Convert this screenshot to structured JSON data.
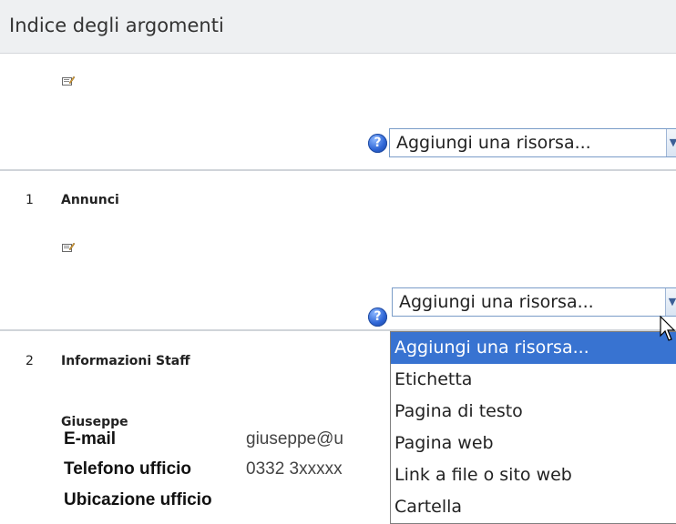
{
  "header": {
    "title": "Indice degli argomenti"
  },
  "sections": [
    {
      "number": "",
      "title": "",
      "add_resource_label": "Aggiungi una risorsa..."
    },
    {
      "number": "1",
      "title": "Annunci",
      "add_resource_label": "Aggiungi una risorsa..."
    },
    {
      "number": "2",
      "title": "Informazioni Staff"
    }
  ],
  "staff": {
    "name": "Giuseppe",
    "rows": [
      {
        "label": "E-mail",
        "value": "giuseppe@u"
      },
      {
        "label": "Telefono ufficio",
        "value": "0332 3xxxxx"
      },
      {
        "label": "Ubicazione ufficio",
        "value": ""
      }
    ]
  },
  "dropdown": {
    "options": [
      "Aggiungi una risorsa...",
      "Etichetta",
      "Pagina di testo",
      "Pagina web",
      "Link a file o sito web",
      "Cartella"
    ],
    "selected_index": 0
  },
  "colors": {
    "header_bg": "#eef0f2",
    "selected_option_bg": "#3873d1",
    "help_icon": "#2f66d6"
  },
  "icons": {
    "edit_summary": "edit-summary-icon",
    "help": "help-icon",
    "cursor": "mouse-pointer-icon"
  }
}
